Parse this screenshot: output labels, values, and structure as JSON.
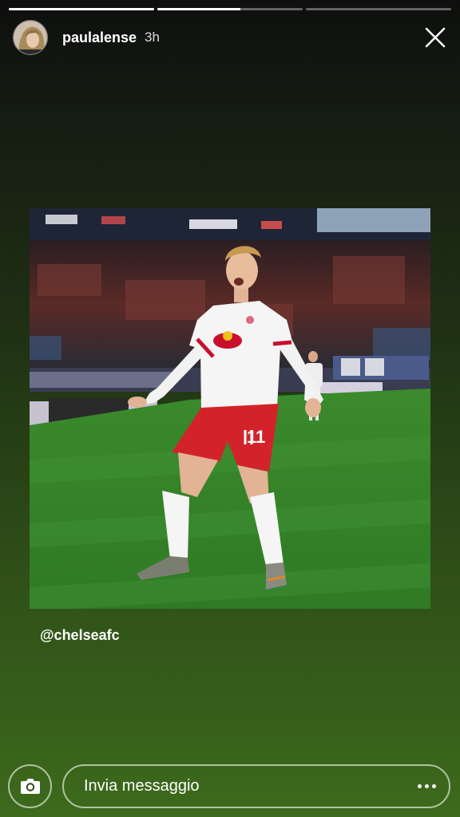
{
  "story": {
    "segments": [
      {
        "progress": 1.0
      },
      {
        "progress": 0.57
      },
      {
        "progress": 0.0
      }
    ],
    "user": {
      "username": "paulalense",
      "time_ago": "3h"
    },
    "icons": {
      "avatar": "profile-avatar",
      "close": "close-icon",
      "camera": "camera-icon",
      "more": "more-horizontal-icon"
    },
    "photo": {
      "subject": "football-player-celebration",
      "jersey_number": "11"
    },
    "mention": "@chelseafc",
    "reply": {
      "placeholder": "Invia messaggio"
    }
  }
}
